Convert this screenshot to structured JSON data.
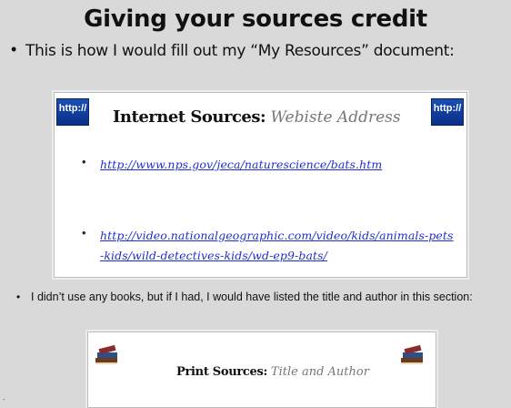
{
  "slide": {
    "title": "Giving your sources credit",
    "bullet1": "This is how I would fill out my “My Resources” document:",
    "bullet_symbol": "•",
    "internet_card": {
      "badge_text": "http://",
      "heading_label": "Internet Sources:",
      "heading_hint": "Webiste Address",
      "links": [
        "http://www.nps.gov/jeca/naturescience/bats.htm",
        "http://video.nationalgeographic.com/video/kids/animals-pets-kids/wild-detectives-kids/wd-ep9-bats/"
      ]
    },
    "bullet2": "I didn’t use any books, but if I had, I would have listed the title and author in this section:",
    "print_card": {
      "heading_label": "Print Sources:",
      "heading_hint": "Title and Author",
      "icon": "books-icon"
    },
    "corner_mark": "-"
  },
  "colors": {
    "background": "#d9d9d9",
    "link": "#1f2fd0",
    "badge": "#0a2f86"
  }
}
